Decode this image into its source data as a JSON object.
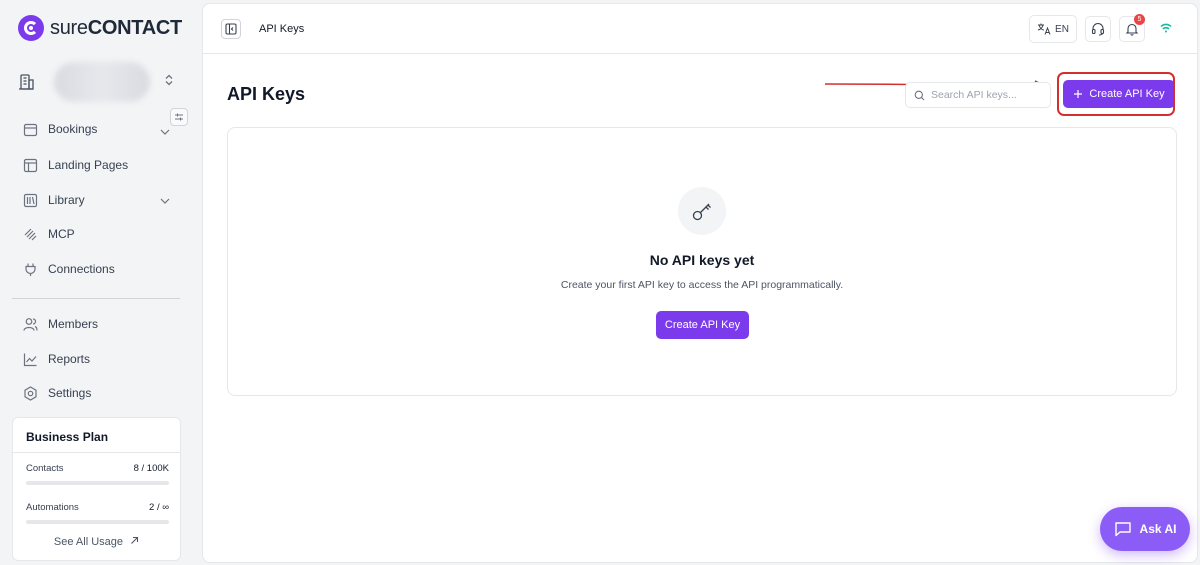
{
  "brand": {
    "name_light": "sure",
    "name_bold": "CONTACT",
    "accent": "#7c3aed"
  },
  "sidebar": {
    "items": [
      {
        "label": "Bookings",
        "icon": "calendar-icon",
        "has_submenu": true
      },
      {
        "label": "Landing Pages",
        "icon": "layout-icon",
        "has_submenu": false
      },
      {
        "label": "Library",
        "icon": "library-icon",
        "has_submenu": true
      },
      {
        "label": "MCP",
        "icon": "mcp-icon",
        "has_submenu": false
      },
      {
        "label": "Connections",
        "icon": "plug-icon",
        "has_submenu": false
      },
      {
        "label": "Members",
        "icon": "users-icon",
        "has_submenu": false
      },
      {
        "label": "Reports",
        "icon": "chart-icon",
        "has_submenu": false
      },
      {
        "label": "Settings",
        "icon": "gear-icon",
        "has_submenu": false
      }
    ]
  },
  "plan": {
    "title": "Business Plan",
    "contacts_label": "Contacts",
    "contacts_value": "8 / 100K",
    "automations_label": "Automations",
    "automations_value": "2 / ∞",
    "see_all": "See All Usage"
  },
  "topbar": {
    "title": "API Keys",
    "language": "EN",
    "notification_count": "5"
  },
  "page": {
    "title": "API Keys",
    "search_placeholder": "Search API keys...",
    "create_button": "Create API Key"
  },
  "empty_state": {
    "title": "No API keys yet",
    "description": "Create your first API key to access the API programmatically.",
    "button": "Create API Key"
  },
  "ask_ai": {
    "label": "Ask AI"
  }
}
